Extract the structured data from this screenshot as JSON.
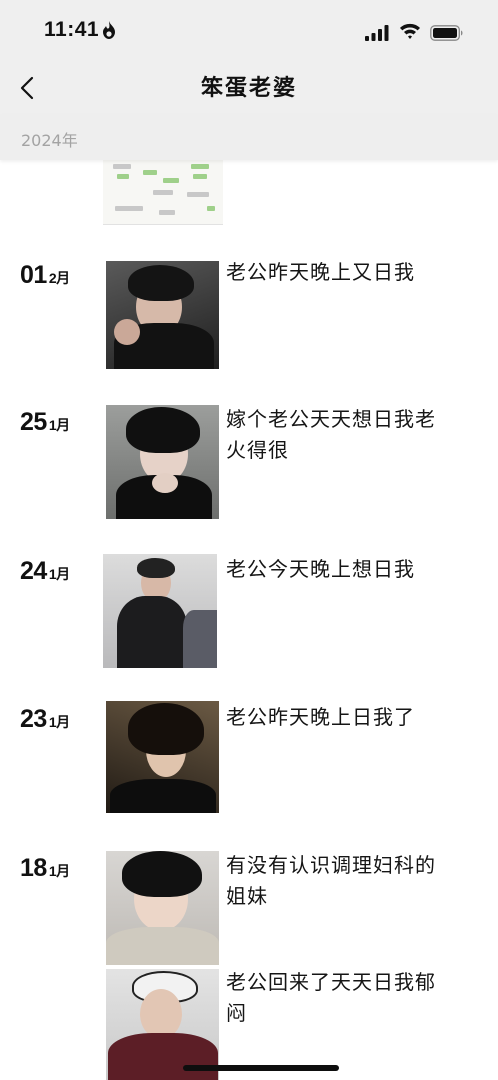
{
  "status_bar": {
    "time": "11:41"
  },
  "nav": {
    "title": "笨蛋老婆"
  },
  "year": "2024年",
  "posts": [
    {
      "day": "01",
      "month": "2月",
      "text": "老公昨天晚上又日我"
    },
    {
      "day": "25",
      "month": "1月",
      "text": "嫁个老公天天想日我老火得很"
    },
    {
      "day": "24",
      "month": "1月",
      "text": "老公今天晚上想日我"
    },
    {
      "day": "23",
      "month": "1月",
      "text": "老公昨天晚上日我了"
    },
    {
      "day": "18",
      "month": "1月",
      "text": "有没有认识调理妇科的姐妹"
    },
    {
      "text": "老公回来了天天日我郁闷"
    }
  ]
}
